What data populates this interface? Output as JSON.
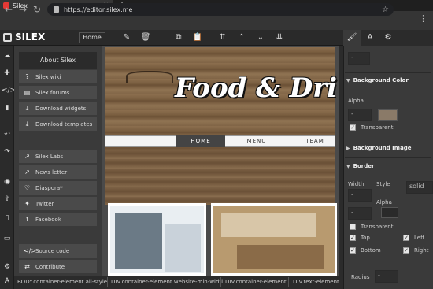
{
  "browser": {
    "tab_title": "Silex",
    "tab_close": "×",
    "new_tab": "+",
    "back": "←",
    "forward": "→",
    "reload": "↻",
    "url": "https://editor.silex.me",
    "star": "☆",
    "menu": "⋮"
  },
  "toolbar": {
    "app_name": "SILEX",
    "home_button": "Home",
    "icons": [
      "pencil-icon",
      "trash-icon",
      "copy-icon",
      "paste-icon",
      "move-to-top-icon",
      "move-up-icon",
      "move-down-icon",
      "move-to-bottom-icon"
    ]
  },
  "rail": {
    "icons": [
      "cloud-icon",
      "plus-icon",
      "code-icon",
      "file-icon",
      "undo-icon",
      "redo-icon",
      "eye-icon",
      "publish-icon",
      "mobile-icon",
      "desktop-icon",
      "settings-icon",
      "text-icon"
    ]
  },
  "menu": {
    "about": "About Silex",
    "items": [
      {
        "label": "Silex wiki",
        "icon": "help-icon"
      },
      {
        "label": "Silex forums",
        "icon": "forum-icon"
      },
      {
        "label": "Download widgets",
        "icon": "download-icon"
      },
      {
        "label": "Download templates",
        "icon": "download-icon"
      },
      {
        "label": "Silex Labs",
        "icon": "external-link-icon"
      },
      {
        "label": "News letter",
        "icon": "external-link-icon"
      },
      {
        "label": "Diaspora*",
        "icon": "heart-icon"
      },
      {
        "label": "Twitter",
        "icon": "twitter-icon"
      },
      {
        "label": "Facebook",
        "icon": "facebook-icon"
      },
      {
        "label": "Source code",
        "icon": "code-icon"
      },
      {
        "label": "Contribute",
        "icon": "contribute-icon"
      }
    ]
  },
  "stage": {
    "site_title": "Food & Dri",
    "nav": [
      "HOME",
      "MENU",
      "TEAM"
    ]
  },
  "panel": {
    "tabs": [
      "brush-icon",
      "font-icon",
      "gear-icon"
    ],
    "top_field": "-",
    "background_color": {
      "title": "Background Color",
      "alpha_label": "Alpha",
      "alpha_value": "-",
      "transparent_label": "Transparent"
    },
    "background_image": {
      "title": "Background Image"
    },
    "border": {
      "title": "Border",
      "width_label": "Width",
      "style_label": "Style",
      "style_value": "solid",
      "width_value": "-",
      "alpha_label": "Alpha",
      "alpha_value": "-",
      "transparent_label": "Transparent",
      "top_label": "Top",
      "left_label": "Left",
      "bottom_label": "Bottom",
      "right_label": "Right"
    },
    "radius": {
      "label": "Radius",
      "value": "-"
    }
  },
  "breadcrumbs": [
    "BODY.container-element.all-style",
    "DIV.container-element.website-min-widtl",
    "DIV.container-element",
    "DIV.text-element"
  ]
}
